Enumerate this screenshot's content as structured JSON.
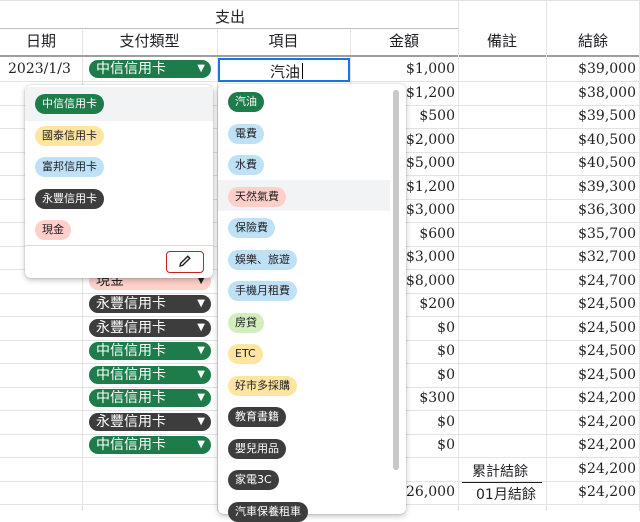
{
  "colors": {
    "green": "#1e7b4a",
    "yellow": "#ffe5a0",
    "blue": "#bfe1f6",
    "dark": "#3d3d3d",
    "red": "#ffcfc9",
    "edit_border": "#c5221f",
    "selection": "#1a73e8"
  },
  "header": {
    "group": "支出",
    "date": "日期",
    "paytype": "支付類型",
    "item": "項目",
    "amount": "金額",
    "note": "備註",
    "balance": "結餘"
  },
  "rows": [
    {
      "date": "2023/1/3",
      "pay": "中信信用卡",
      "amount": "$1,000",
      "balance": "$39,000"
    },
    {
      "date": "",
      "pay": "",
      "amount": "$1,200",
      "balance": "$38,000"
    },
    {
      "date": "",
      "pay": "",
      "amount": "$500",
      "balance": "$39,500"
    },
    {
      "date": "",
      "pay": "",
      "amount": "$2,000",
      "balance": "$40,500"
    },
    {
      "date": "",
      "pay": "",
      "amount": "$5,000",
      "balance": "$40,500"
    },
    {
      "date": "",
      "pay": "",
      "amount": "$1,200",
      "balance": "$39,300"
    },
    {
      "date": "",
      "pay": "",
      "amount": "$3,000",
      "balance": "$36,300"
    },
    {
      "date": "",
      "pay": "",
      "amount": "$600",
      "balance": "$35,700"
    },
    {
      "date": "",
      "pay": "",
      "amount": "$3,000",
      "balance": "$32,700"
    },
    {
      "date": "",
      "pay": "現金",
      "amount": "$8,000",
      "balance": "$24,700"
    },
    {
      "date": "",
      "pay": "永豐信用卡",
      "amount": "$200",
      "balance": "$24,500"
    },
    {
      "date": "",
      "pay": "永豐信用卡",
      "amount": "$0",
      "balance": "$24,500"
    },
    {
      "date": "",
      "pay": "中信信用卡",
      "amount": "$0",
      "balance": "$24,500"
    },
    {
      "date": "",
      "pay": "中信信用卡",
      "amount": "$0",
      "balance": "$24,500"
    },
    {
      "date": "",
      "pay": "中信信用卡",
      "amount": "$300",
      "balance": "$24,200"
    },
    {
      "date": "",
      "pay": "永豐信用卡",
      "amount": "$0",
      "balance": "$24,200"
    },
    {
      "date": "",
      "pay": "中信信用卡",
      "amount": "$0",
      "balance": "$24,200"
    }
  ],
  "summary": {
    "cumulative_label": "累計結餘",
    "cumulative_value": "$24,200",
    "month_amount": "26,000",
    "month_label": "01月結餘",
    "month_value": "$24,200"
  },
  "active_cell": {
    "value": "汽油"
  },
  "pay_menu": {
    "options": [
      {
        "label": "中信信用卡",
        "color": "green"
      },
      {
        "label": "國泰信用卡",
        "color": "yellow"
      },
      {
        "label": "富邦信用卡",
        "color": "blue"
      },
      {
        "label": "永豐信用卡",
        "color": "dark"
      },
      {
        "label": "現金",
        "color": "red"
      }
    ],
    "edit_icon": "pencil-icon"
  },
  "item_menu": {
    "options": [
      {
        "label": "汽油",
        "color": "green"
      },
      {
        "label": "電費",
        "color": "blue"
      },
      {
        "label": "水費",
        "color": "blue"
      },
      {
        "label": "天然氣費",
        "color": "red"
      },
      {
        "label": "保險費",
        "color": "blue"
      },
      {
        "label": "娛樂、旅遊",
        "color": "blue"
      },
      {
        "label": "手機月租費",
        "color": "blue"
      },
      {
        "label": "房貸",
        "color": "lightgreen"
      },
      {
        "label": "ETC",
        "color": "yellow"
      },
      {
        "label": "好市多採購",
        "color": "yellow"
      },
      {
        "label": "教育書籍",
        "color": "dark"
      },
      {
        "label": "嬰兒用品",
        "color": "dark"
      },
      {
        "label": "家電3C",
        "color": "dark"
      },
      {
        "label": "汽車保養租車",
        "color": "dark"
      }
    ]
  }
}
